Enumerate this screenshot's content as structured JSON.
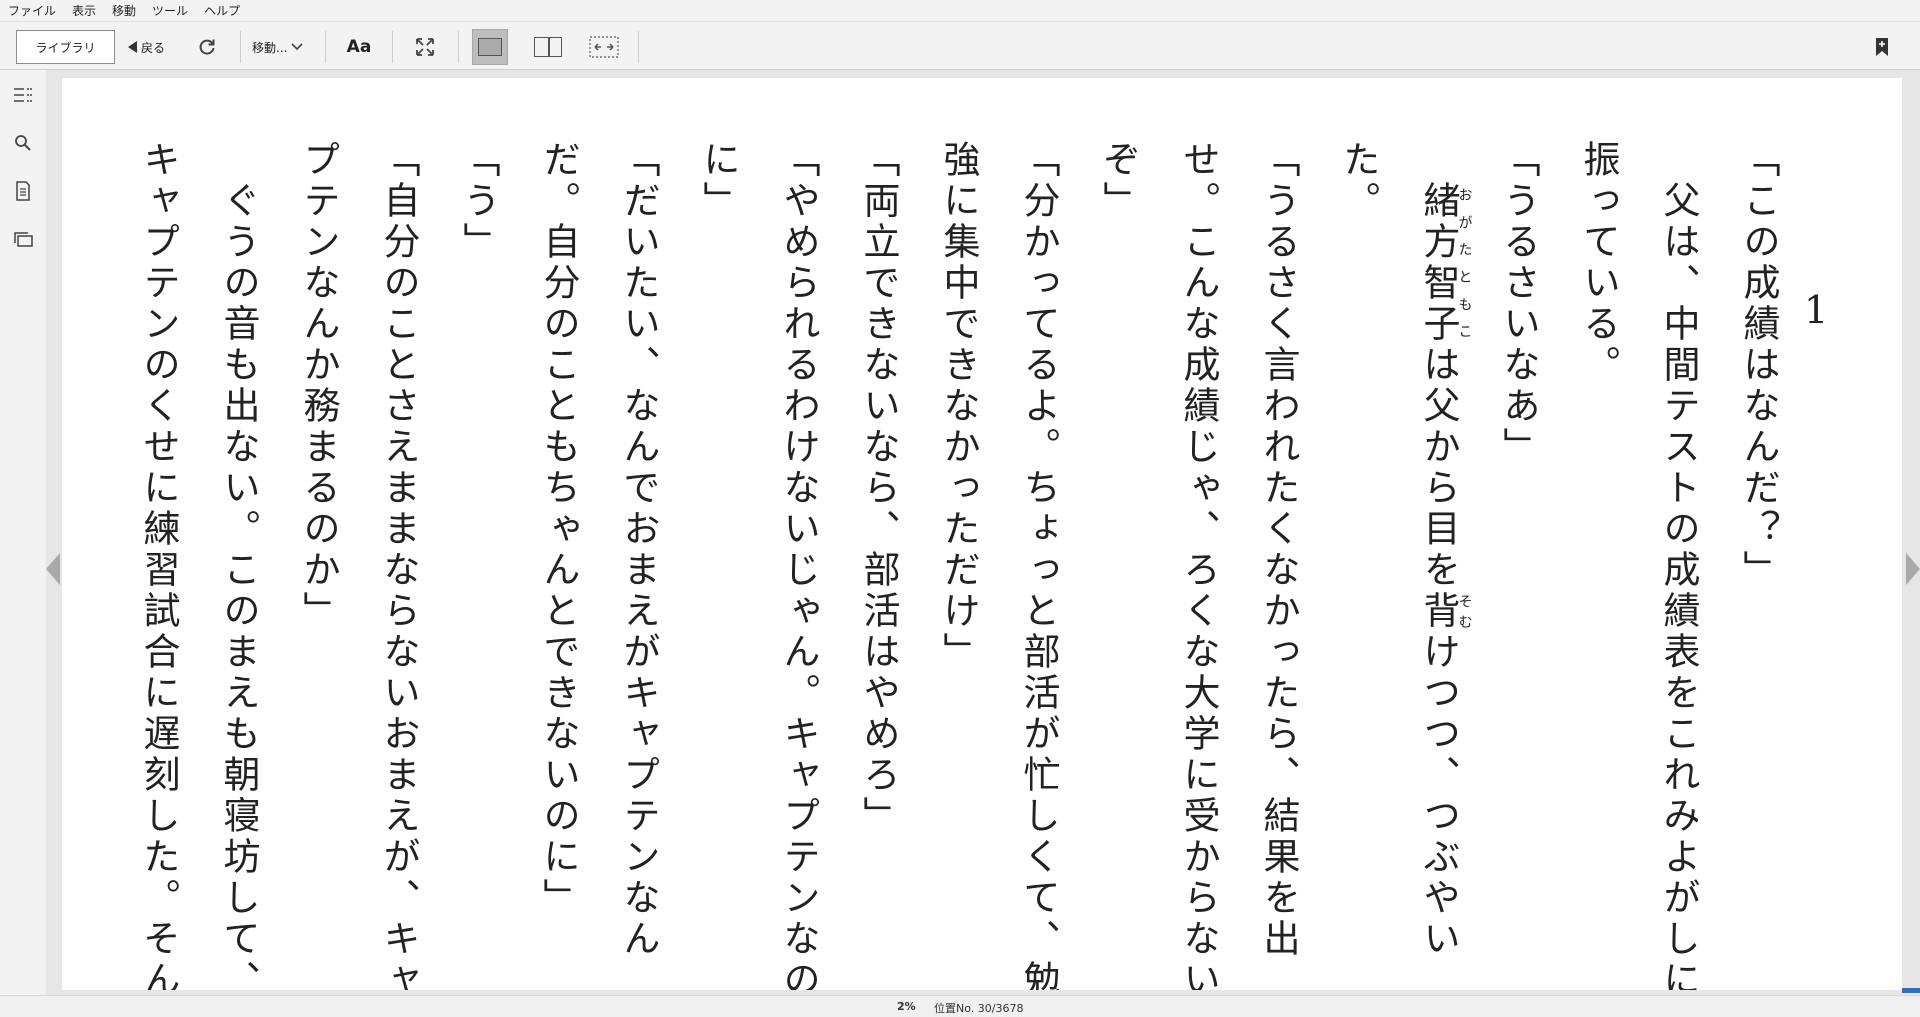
{
  "menu": [
    "ファイル",
    "表示",
    "移動",
    "ツール",
    "ヘルプ"
  ],
  "toolbar": {
    "library_label": "ライブラリ",
    "back_label": "戻る",
    "goto_label": "移動...",
    "font_label": "Aa"
  },
  "book": {
    "chapter_number": "1",
    "paragraphs": [
      "「この成績はなんだ？」",
      "　父は、中間テストの成績表をこれみよがしに振っている。",
      "「うるさいなあ」",
      "　緒方智子は父から目を背けつつ、つぶやいた。",
      "「うるさく言われたくなかったら、結果を出せ。こんな成績じゃ、ろくな大学に受からないぞ」",
      "「分かってるよ。ちょっと部活が忙しくて、勉強に集中できなかっただけ」",
      "「両立できないなら、部活はやめろ」",
      "「やめられるわけないじゃん。キャプテンなのに」",
      "「だいたい、なんでおまえがキャプテンなんだ。自分のこともちゃんとできないのに」",
      "「う」",
      "「自分のことさえままならないおまえが、キャプテンなんか務まるのか」",
      "　ぐうの音も出ない。このまえも朝寝坊して、キャプテンのくせに練習試合に遅刻した。そん"
    ],
    "ruby": {
      "name_reading": "おがたともこ",
      "somu_reading": "そむ"
    }
  },
  "status": {
    "percent": "2%",
    "location": "位置No. 30/3678",
    "progress_fraction": 0.02
  }
}
